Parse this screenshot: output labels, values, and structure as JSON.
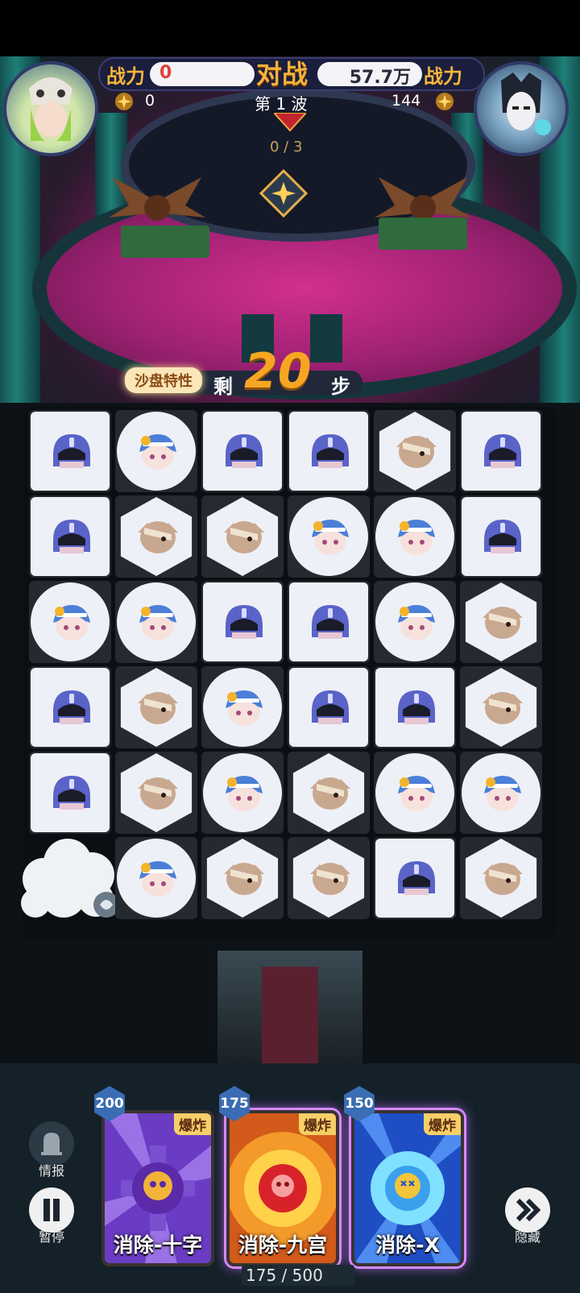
{
  "hud": {
    "left_power_label": "战力",
    "left_power_value": "0",
    "vs_label": "对战",
    "right_power_value": "57.7万",
    "right_power_label": "战力",
    "left_points": "0",
    "wave_label": "第 1 波",
    "right_points": "144",
    "progress_text": "0 / 3"
  },
  "banner": {
    "trait_label": "沙盘特性",
    "remaining_prefix": "剩",
    "steps_value": "20",
    "steps_suffix": "步"
  },
  "board": {
    "legend": {
      "A": "hooded-purple-piece",
      "B": "blue-hair-girl-piece",
      "C": "bandaged-head-piece"
    },
    "rows": [
      [
        "A",
        "B",
        "A",
        "A",
        "C",
        "A"
      ],
      [
        "A",
        "C",
        "C",
        "B",
        "B",
        "A"
      ],
      [
        "B",
        "B",
        "A",
        "A",
        "B",
        "C"
      ],
      [
        "A",
        "C",
        "B",
        "A",
        "A",
        "C"
      ],
      [
        "A",
        "C",
        "B",
        "C",
        "B",
        "B"
      ],
      [
        "cloud",
        "B",
        "C",
        "C",
        "A",
        "C"
      ]
    ]
  },
  "skills": [
    {
      "cost": "200",
      "tag": "爆炸",
      "name": "消除-十字"
    },
    {
      "cost": "175",
      "tag": "爆炸",
      "name": "消除-九宫"
    },
    {
      "cost": "150",
      "tag": "爆炸",
      "name": "消除-X"
    }
  ],
  "energy": "175 / 500",
  "side_buttons": {
    "info": "情报",
    "pause": "暂停",
    "hide": "隐藏"
  },
  "colors": {
    "gold": "#f6b73b",
    "orange_steps": "#f7a623",
    "card_selected_border": "#d58bff"
  }
}
